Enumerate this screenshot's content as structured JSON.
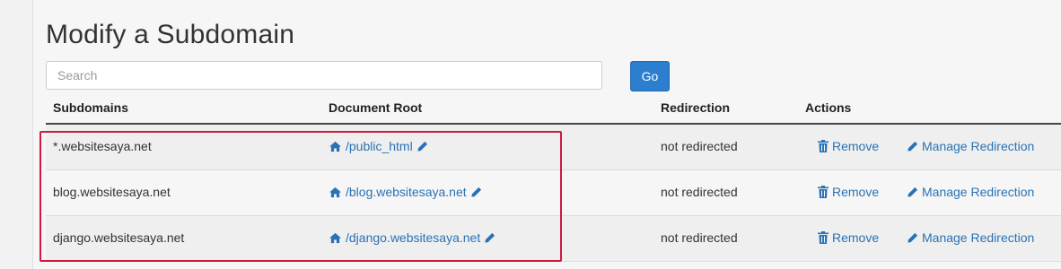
{
  "page": {
    "title": "Modify a Subdomain"
  },
  "search": {
    "placeholder": "Search",
    "value": ""
  },
  "go_button": {
    "label": "Go"
  },
  "table": {
    "headers": {
      "subdomains": "Subdomains",
      "document_root": "Document Root",
      "redirection": "Redirection",
      "actions": "Actions"
    },
    "rows": [
      {
        "subdomain": "*.websitesaya.net",
        "document_root": "/public_html",
        "redirection": "not redirected",
        "remove": "Remove",
        "manage": "Manage Redirection"
      },
      {
        "subdomain": "blog.websitesaya.net",
        "document_root": "/blog.websitesaya.net",
        "redirection": "not redirected",
        "remove": "Remove",
        "manage": "Manage Redirection"
      },
      {
        "subdomain": "django.websitesaya.net",
        "document_root": "/django.websitesaya.net",
        "redirection": "not redirected",
        "remove": "Remove",
        "manage": "Manage Redirection"
      }
    ]
  },
  "icons": {
    "home": "home-icon",
    "edit": "pencil-icon",
    "remove": "trash-icon",
    "manage": "pencil-icon"
  },
  "colors": {
    "accent": "#2b7fce",
    "link": "#2a72b5",
    "highlight": "#d0193f"
  }
}
